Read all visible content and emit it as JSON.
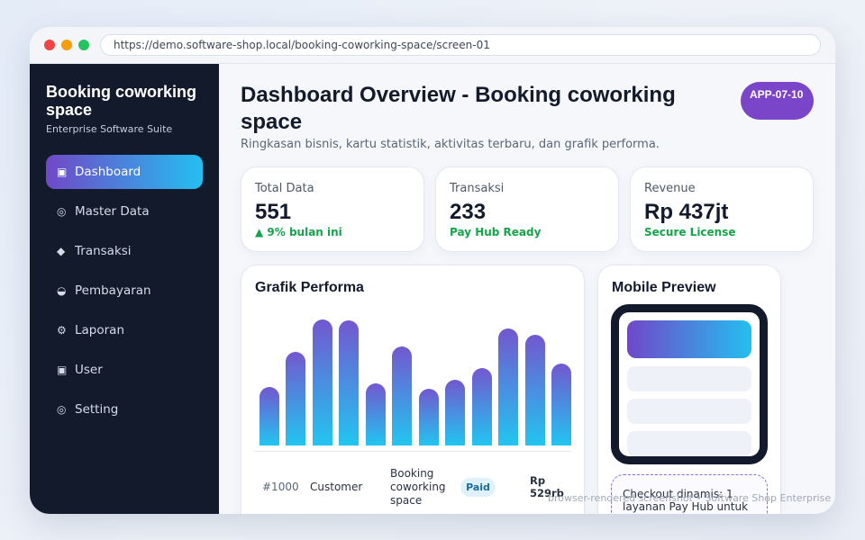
{
  "browser": {
    "url": "https://demo.software-shop.local/booking-coworking-space/screen-01"
  },
  "sidebar": {
    "brand_title": "Booking coworking space",
    "brand_subtitle": "Enterprise Software Suite",
    "items": [
      {
        "label": "Dashboard",
        "icon": "square-icon",
        "glyph": "▣",
        "active": true
      },
      {
        "label": "Master Data",
        "icon": "target-icon",
        "glyph": "◎",
        "active": false
      },
      {
        "label": "Transaksi",
        "icon": "diamond-icon",
        "glyph": "◆",
        "active": false
      },
      {
        "label": "Pembayaran",
        "icon": "half-circle-icon",
        "glyph": "◒",
        "active": false
      },
      {
        "label": "Laporan",
        "icon": "gear-icon",
        "glyph": "⚙",
        "active": false
      },
      {
        "label": "User",
        "icon": "square-icon",
        "glyph": "▣",
        "active": false
      },
      {
        "label": "Setting",
        "icon": "target-icon",
        "glyph": "◎",
        "active": false
      }
    ]
  },
  "header": {
    "title": "Dashboard Overview - Booking coworking space",
    "badge": "APP-07-10",
    "subtitle": "Ringkasan bisnis, kartu statistik, aktivitas terbaru, dan grafik performa."
  },
  "stats": [
    {
      "label": "Total Data",
      "value": "551",
      "note": "▲ 9% bulan ini"
    },
    {
      "label": "Transaksi",
      "value": "233",
      "note": "Pay Hub Ready"
    },
    {
      "label": "Revenue",
      "value": "Rp 437jt",
      "note": "Secure License"
    }
  ],
  "chart": {
    "title": "Grafik Performa"
  },
  "chart_data": {
    "type": "bar",
    "title": "Grafik Performa",
    "values": [
      52,
      83,
      112,
      111,
      55,
      88,
      50,
      58,
      69,
      104,
      98,
      73
    ],
    "ylim": [
      0,
      120
    ]
  },
  "table": {
    "rows": [
      {
        "id": "#1000",
        "customer": "Customer",
        "service": "Booking coworking space",
        "status": "Paid",
        "amount": "Rp 529rb"
      }
    ]
  },
  "mobile": {
    "title": "Mobile Preview",
    "checkout_text": "Checkout dinamis: 1 layanan Pay Hub untuk"
  },
  "footer": {
    "note": "browser-rendered screenshot • Software Shop Enterprise"
  },
  "colors": {
    "accent_purple": "#7048c8",
    "accent_cyan": "#24bff0",
    "sidebar_bg": "#121a2b",
    "success": "#16a34a"
  }
}
